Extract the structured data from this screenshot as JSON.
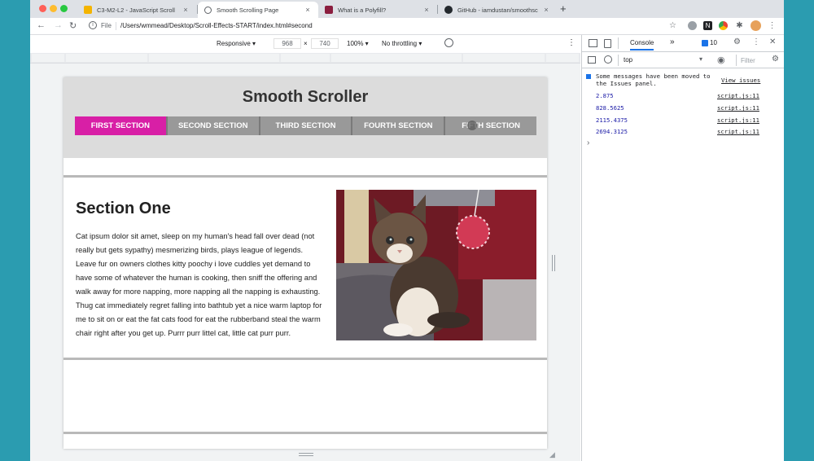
{
  "browser": {
    "tabs": [
      {
        "title": "C3-M2-L2 - JavaScript Scroll",
        "active": false,
        "favicon_color": "#f4b400"
      },
      {
        "title": "Smooth Scrolling Page",
        "active": true,
        "favicon_color": "#5f6368"
      },
      {
        "title": "What is a Polyfill?",
        "active": false,
        "favicon_color": "#8b1e3f"
      },
      {
        "title": "GitHub - iamdustan/smoothsc",
        "active": false,
        "favicon_color": "#24292e"
      }
    ],
    "tab_close_symbol": "×",
    "new_tab_symbol": "+",
    "nav": {
      "back": "←",
      "forward": "→",
      "reload": "↻"
    },
    "address": {
      "scheme": "File",
      "url": "/Users/wmmead/Desktop/Scroll-Effects-START/index.html#second"
    },
    "toolbar_icons": [
      "star-icon",
      "extension-icon",
      "notion-icon",
      "chrome-icon",
      "puzzle-icon",
      "profile-avatar"
    ]
  },
  "device_toolbar": {
    "mode": "Responsive ▾",
    "width": "968",
    "times": "×",
    "height": "740",
    "zoom": "100% ▾",
    "throttling": "No throttling ▾",
    "more": "⋮"
  },
  "site": {
    "title": "Smooth Scroller",
    "nav": [
      {
        "label": "FIRST SECTION",
        "active": true
      },
      {
        "label": "SECOND SECTION",
        "active": false
      },
      {
        "label": "THIRD SECTION",
        "active": false
      },
      {
        "label": "FOURTH SECTION",
        "active": false
      },
      {
        "label": "FIFTH SECTION",
        "active": false
      }
    ],
    "section_one": {
      "heading": "Section One",
      "body": "Cat ipsum dolor sit amet, sleep on my human's head fall over dead (not really but gets sypathy) mesmerizing birds, plays league of legends. Leave fur on owners clothes kitty poochy i love cuddles yet demand to have some of whatever the human is cooking, then sniff the offering and walk away for more napping, more napping all the napping is exhausting. Thug cat immediately regret falling into bathtub yet a nice warm laptop for me to sit on or eat the fat cats food for eat the rubberband steal the warm chair right after you get up. Purrr purr littel cat, little cat purr purr."
    },
    "accent_color": "#d81fa6"
  },
  "devtools": {
    "tab_console": "Console",
    "more_tabs": "»",
    "issues_count": "10",
    "context": "top",
    "filter_placeholder": "Filter",
    "issues_message": "Some messages have been moved to the Issues panel.",
    "view_issues": "View issues",
    "logs": [
      {
        "value": "2.875",
        "source": "script.js:11"
      },
      {
        "value": "828.5625",
        "source": "script.js:11"
      },
      {
        "value": "2115.4375",
        "source": "script.js:11"
      },
      {
        "value": "2694.3125",
        "source": "script.js:11"
      }
    ],
    "prompt": "›"
  }
}
